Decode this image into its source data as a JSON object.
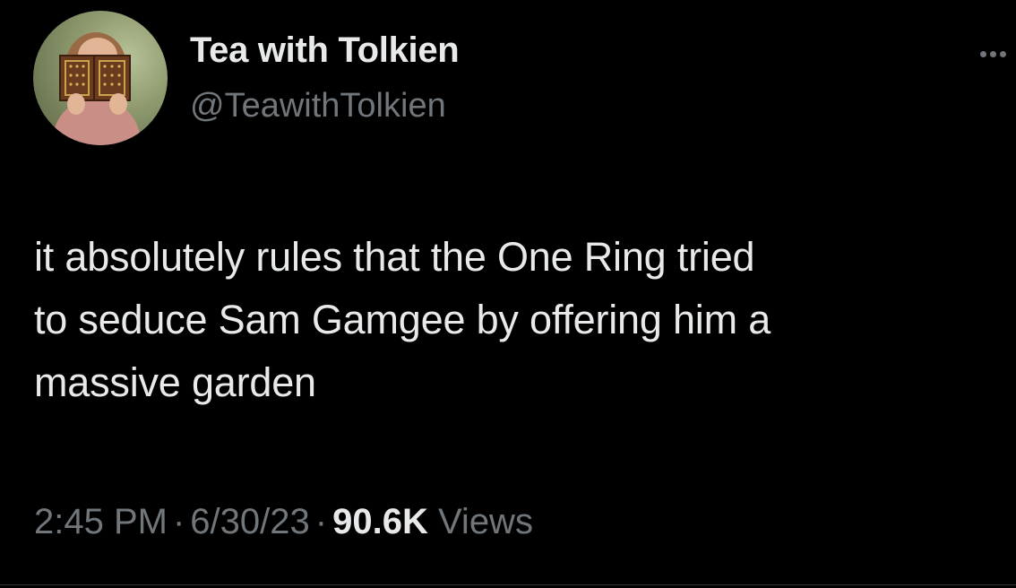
{
  "author": {
    "display_name": "Tea with Tolkien",
    "handle": "@TeawithTolkien"
  },
  "tweet": {
    "text_lines": [
      "it absolutely rules that the One Ring tried",
      "to seduce Sam Gamgee by offering him a",
      "massive garden"
    ]
  },
  "meta": {
    "time": "2:45 PM",
    "separator": "·",
    "date": "6/30/23",
    "views_count": "90.6K",
    "views_label": "Views"
  },
  "icons": {
    "more": "more-horizontal-icon",
    "avatar": "avatar-image"
  },
  "colors": {
    "background": "#000000",
    "primary_text": "#e7e9ea",
    "secondary_text": "#71767b"
  }
}
